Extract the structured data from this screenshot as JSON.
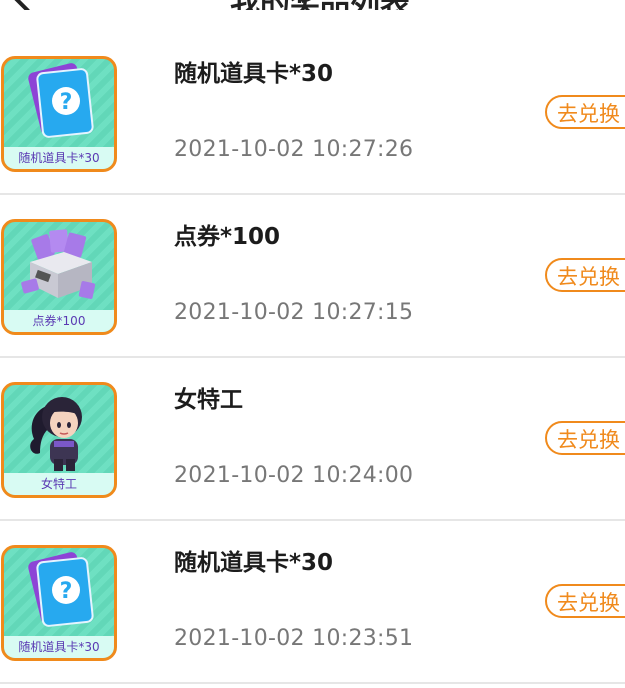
{
  "header": {
    "title": "我的奖品列表"
  },
  "items": [
    {
      "name": "随机道具卡*30",
      "time": "2021-10-02 10:27:26",
      "thumb_caption": "随机道具卡*30",
      "art_icon": "random-card-icon",
      "button_label": "去兑换"
    },
    {
      "name": "点券*100",
      "time": "2021-10-02 10:27:15",
      "thumb_caption": "点券*100",
      "art_icon": "coupon-box-icon",
      "button_label": "去兑换"
    },
    {
      "name": "女特工",
      "time": "2021-10-02 10:24:00",
      "thumb_caption": "女特工",
      "art_icon": "female-agent-icon",
      "button_label": "去兑换"
    },
    {
      "name": "随机道具卡*30",
      "time": "2021-10-02 10:23:51",
      "thumb_caption": "随机道具卡*30",
      "art_icon": "random-card-icon",
      "button_label": "去兑换"
    }
  ],
  "colors": {
    "accent": "#f08a1c",
    "thumb_bg": "#62d7b8",
    "caption_text": "#5a39b3",
    "time_text": "#777777",
    "divider": "#e6e6e6"
  }
}
